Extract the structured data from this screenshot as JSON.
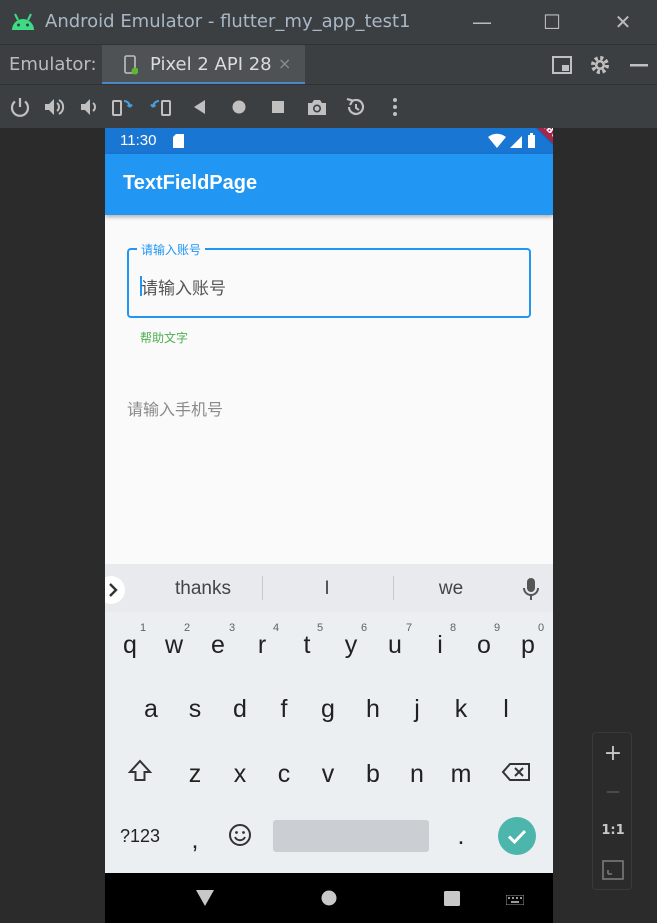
{
  "window": {
    "title": "Android Emulator - flutter_my_app_test1",
    "minimize": "—",
    "maximize": "☐",
    "close": "✕"
  },
  "emulator_bar": {
    "label": "Emulator:",
    "tab_name": "Pixel 2 API 28",
    "tab_close": "×"
  },
  "toolbar_icons": [
    "power-icon",
    "volume-up-icon",
    "volume-down-icon",
    "rotate-left-icon",
    "rotate-right-icon",
    "back-icon",
    "home-icon",
    "overview-icon",
    "screenshot-icon",
    "snapshot-icon",
    "more-icon"
  ],
  "phone": {
    "status": {
      "time": "11:30"
    },
    "debug_banner": "DEBUG",
    "appbar_title": "TextFieldPage",
    "account_field": {
      "label": "请输入账号",
      "value": "请输入账号",
      "helper": "帮助文字"
    },
    "phone_field": {
      "placeholder": "请输入手机号"
    },
    "keyboard": {
      "suggestions": [
        "thanks",
        "I",
        "we"
      ],
      "row1": [
        "q",
        "w",
        "e",
        "r",
        "t",
        "y",
        "u",
        "i",
        "o",
        "p"
      ],
      "row1_hints": [
        "1",
        "2",
        "3",
        "4",
        "5",
        "6",
        "7",
        "8",
        "9",
        "0"
      ],
      "row2": [
        "a",
        "s",
        "d",
        "f",
        "g",
        "h",
        "j",
        "k",
        "l"
      ],
      "row3": [
        "z",
        "x",
        "c",
        "v",
        "b",
        "n",
        "m"
      ],
      "symbols": "?123",
      "comma": ",",
      "period": "."
    }
  },
  "side_panel": {
    "zoom_in": "+",
    "zoom_out": "—",
    "ratio": "1:1"
  },
  "colors": {
    "appbar": "#2196f3",
    "statusbar": "#1976d2",
    "helper": "#4caf50",
    "accent": "#4db6ac"
  }
}
